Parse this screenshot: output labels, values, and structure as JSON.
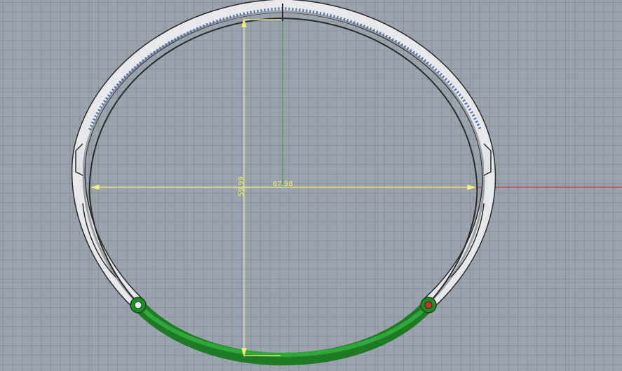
{
  "viewport": {
    "background": "#9ba4ae",
    "grid_color": "#7f8893",
    "axis_x_color": "#c23b3b",
    "axis_y_color": "#3a9a3a"
  },
  "dimensions": {
    "width_label": "67.98",
    "height_label": "59.99",
    "color": "#f0f07a"
  },
  "model": {
    "ring_color": "#e7e9ec",
    "outline_color": "#2a2a2a",
    "selected_segment_color": "#1f8c2a",
    "start_point_color": "#1f8c2a",
    "end_point_color": "#c0392b"
  }
}
